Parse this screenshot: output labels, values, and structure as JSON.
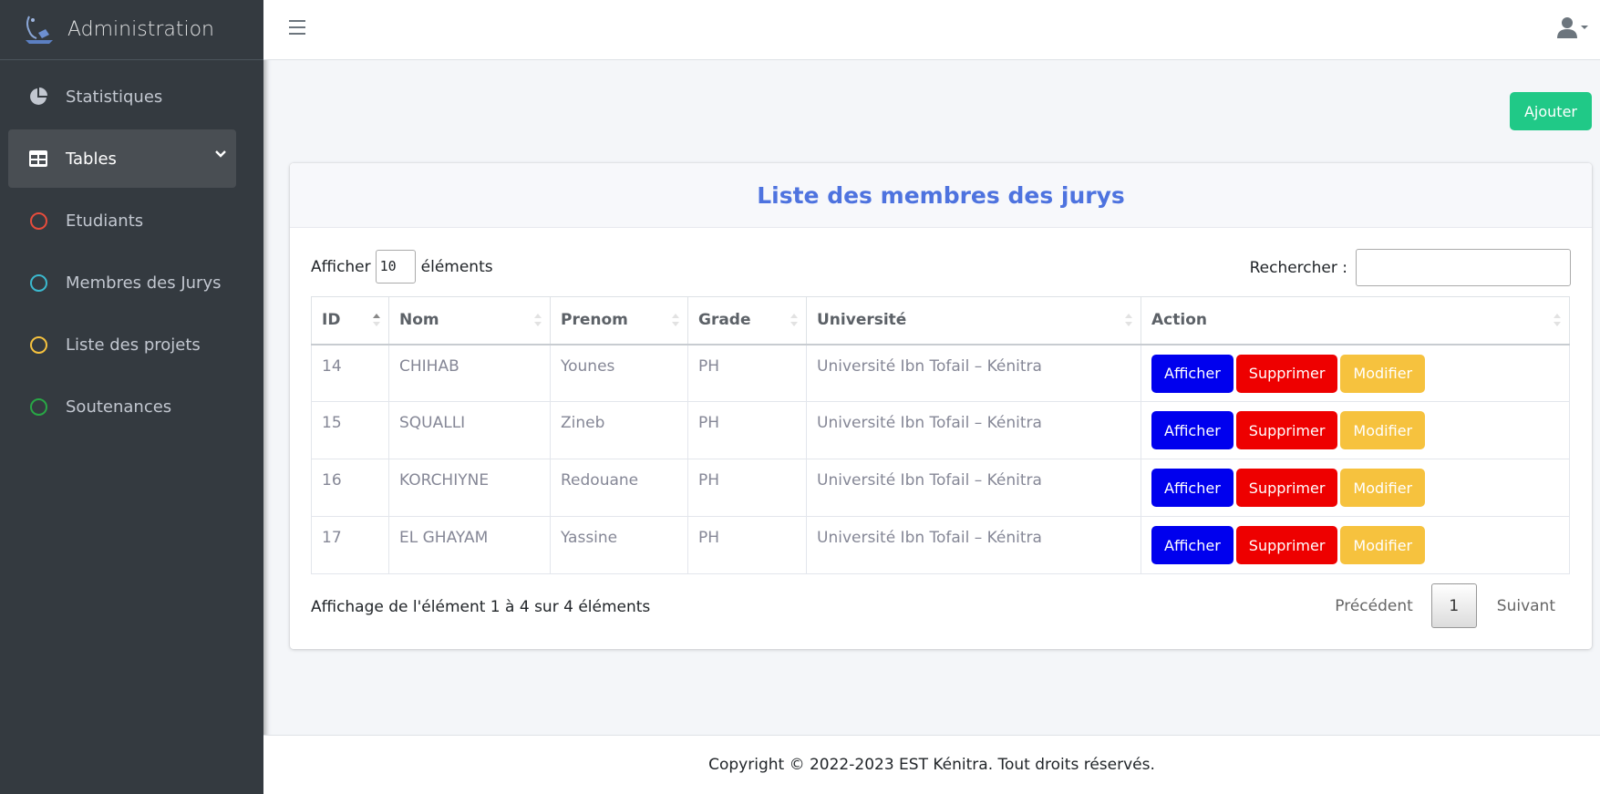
{
  "brand": {
    "title": "Administration",
    "logo": "admin-logo-icon"
  },
  "sidebar": {
    "items": [
      {
        "label": "Statistiques",
        "icon": "pie-chart-icon"
      },
      {
        "label": "Tables",
        "icon": "table-icon",
        "active": true
      },
      {
        "label": "Etudiants",
        "icon": "circle-icon",
        "color": "#e74c3c"
      },
      {
        "label": "Membres des Jurys",
        "icon": "circle-icon",
        "color": "#3bb9cf"
      },
      {
        "label": "Liste des projets",
        "icon": "circle-icon",
        "color": "#f6c23e"
      },
      {
        "label": "Soutenances",
        "icon": "circle-icon",
        "color": "#28a745"
      }
    ]
  },
  "toolbar": {
    "add_label": "Ajouter"
  },
  "card": {
    "title": "Liste des membres des jurys"
  },
  "length": {
    "prefix": "Afficher",
    "value": "10",
    "suffix": "éléments"
  },
  "search": {
    "label": "Rechercher :",
    "value": ""
  },
  "table": {
    "columns": [
      "ID",
      "Nom",
      "Prenom",
      "Grade",
      "Université",
      "Action"
    ],
    "rows": [
      {
        "id": "14",
        "nom": "CHIHAB",
        "prenom": "Younes",
        "grade": "PH",
        "universite": "Université Ibn Tofail – Kénitra"
      },
      {
        "id": "15",
        "nom": "SQUALLI",
        "prenom": "Zineb",
        "grade": "PH",
        "universite": "Université Ibn Tofail – Kénitra"
      },
      {
        "id": "16",
        "nom": "KORCHIYNE",
        "prenom": "Redouane",
        "grade": "PH",
        "universite": "Université Ibn Tofail – Kénitra"
      },
      {
        "id": "17",
        "nom": "EL GHAYAM",
        "prenom": "Yassine",
        "grade": "PH",
        "universite": "Université Ibn Tofail – Kénitra"
      }
    ],
    "actions": {
      "show": "Afficher",
      "delete": "Supprimer",
      "edit": "Modifier"
    }
  },
  "info": "Affichage de l'élément 1 à 4 sur 4 éléments",
  "pagination": {
    "prev": "Précédent",
    "current": "1",
    "next": "Suivant"
  },
  "colors": {
    "sidebar": "#343a40",
    "title": "#4e73df",
    "add": "#20c987",
    "show": "#0000ee",
    "delete": "#ee0000",
    "edit": "#f6c23e"
  },
  "footer": "Copyright © 2022-2023 EST Kénitra. Tout droits réservés."
}
